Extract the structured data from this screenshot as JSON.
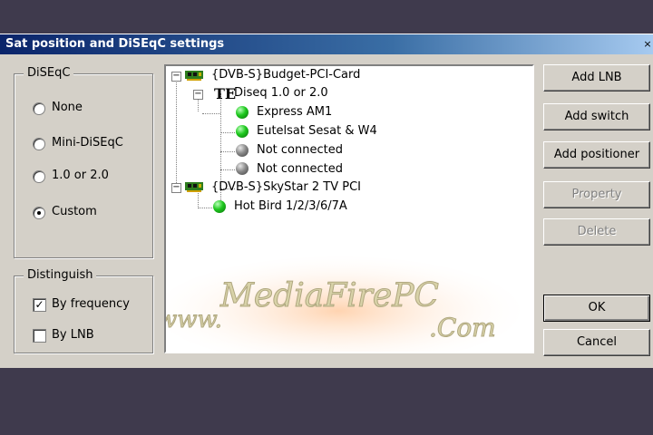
{
  "window": {
    "title": "Sat position and DiSEqC settings",
    "close_glyph": "×"
  },
  "diseqc": {
    "legend": "DiSEqC",
    "options": [
      {
        "label": "None",
        "checked": false
      },
      {
        "label": "Mini-DiSEqC",
        "checked": false
      },
      {
        "label": "1.0 or 2.0",
        "checked": false
      },
      {
        "label": "Custom",
        "checked": true
      }
    ]
  },
  "distinguish": {
    "legend": "Distinguish",
    "options": [
      {
        "label": "By frequency",
        "checked": true
      },
      {
        "label": "By LNB",
        "checked": false
      }
    ]
  },
  "tree": {
    "card1": "{DVB-S}Budget-PCI-Card",
    "switch1": "Diseq 1.0 or 2.0",
    "sat1": "Express AM1",
    "sat2": "Eutelsat Sesat & W4",
    "nc1": "Not connected",
    "nc2": "Not connected",
    "card2": "{DVB-S}SkyStar 2 TV PCI",
    "sat3": "Hot Bird 1/2/3/6/7A",
    "expanded_glyph": "−"
  },
  "buttons": {
    "add_lnb": "Add LNB",
    "add_switch": "Add switch",
    "add_positioner": "Add positioner",
    "property": "Property",
    "delete": "Delete",
    "ok": "OK",
    "cancel": "Cancel"
  },
  "watermark": {
    "line1": "MediaFirePC",
    "prefix": "www.",
    "suffix": ".Com"
  },
  "colors": {
    "face": "#d4d0c8",
    "title_start": "#0a246a",
    "title_end": "#a6caf0",
    "status_green": "#1ec81e",
    "status_gray": "#8a8a8a",
    "background": "#3f3a4d"
  }
}
